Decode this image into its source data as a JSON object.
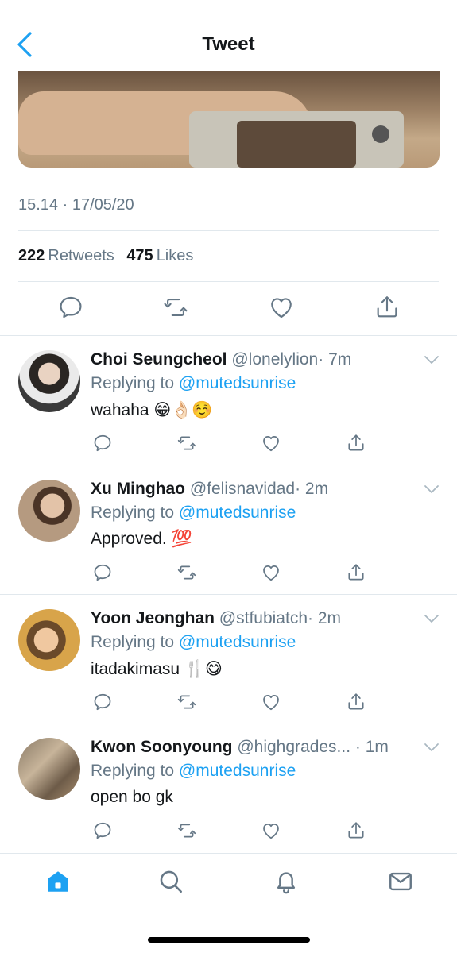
{
  "header": {
    "title": "Tweet"
  },
  "tweet": {
    "timestamp": "15.14 · 17/05/20",
    "retweets_count": "222",
    "retweets_label": "Retweets",
    "likes_count": "475",
    "likes_label": "Likes"
  },
  "replies": [
    {
      "name": "Choi Seungcheol",
      "handle": "@lonelylion",
      "time": "· 7m",
      "replying_prefix": "Replying to",
      "mention": "@mutedsunrise",
      "text": "wahaha 😁👌🏻☺️"
    },
    {
      "name": "Xu Minghao",
      "handle": "@felisnavidad",
      "time": "· 2m",
      "replying_prefix": "Replying to",
      "mention": "@mutedsunrise",
      "text": "Approved. 💯"
    },
    {
      "name": "Yoon Jeonghan",
      "handle": "@stfubiatch",
      "time": "· 2m",
      "replying_prefix": "Replying to",
      "mention": "@mutedsunrise",
      "text": "itadakimasu 🍴😋"
    },
    {
      "name": "Kwon Soonyoung",
      "handle": "@highgrades...",
      "time": "· 1m",
      "replying_prefix": "Replying to",
      "mention": "@mutedsunrise",
      "text": "open bo gk"
    }
  ],
  "icons": {
    "reply": "reply-icon",
    "retweet": "retweet-icon",
    "like": "heart-icon",
    "share": "share-icon",
    "home": "home-icon",
    "search": "search-icon",
    "notifications": "bell-icon",
    "messages": "mail-icon"
  },
  "colors": {
    "accent": "#1da1f2",
    "secondary_text": "#657786",
    "icon": "#657786"
  }
}
